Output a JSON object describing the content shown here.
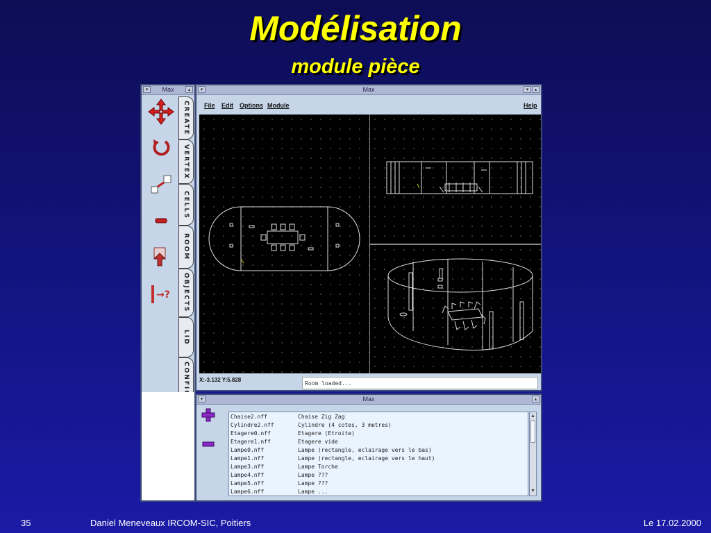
{
  "slide": {
    "title": "Modélisation",
    "subtitle": "module pièce",
    "footer_page": "35",
    "footer_author": "Daniel Meneveaux IRCOM-SIC, Poitiers",
    "footer_date": "Le 17.02.2000"
  },
  "palette": {
    "title": "Max",
    "tools": [
      "move-arrows-icon",
      "rotate-icon",
      "scale-icon",
      "minus-icon",
      "download-icon",
      "help-cursor-icon"
    ],
    "tabs": [
      "CREATE",
      "VERTEX",
      "CELLS",
      "ROOM",
      "OBJECTS",
      "LID",
      "CONFIG"
    ]
  },
  "viewer": {
    "title": "Max",
    "menu": {
      "file": "File",
      "edit": "Edit",
      "options": "Options",
      "module": "Module",
      "help": "Help"
    },
    "coords": "X:-3.132 Y:5.828",
    "status": "Room loaded..."
  },
  "files": {
    "title": "Max",
    "add_icon": "plus-icon",
    "remove_icon": "minus-icon",
    "rows": [
      {
        "file": "Chaise2.nff",
        "desc": "Chaise Zig Zag"
      },
      {
        "file": "Cylindre2.nff",
        "desc": "Cylindre (4 cotes, 3 metres)"
      },
      {
        "file": "Etagere0.nff",
        "desc": "Etagere (Etroite)"
      },
      {
        "file": "Etagere1.nff",
        "desc": "Etagere vide"
      },
      {
        "file": "Lampe0.nff",
        "desc": "Lampe (rectangle, eclairage vers le bas)"
      },
      {
        "file": "Lampe1.nff",
        "desc": "Lampe (rectangle, eclairage vers le haut)"
      },
      {
        "file": "Lampe3.nff",
        "desc": "Lampe Torche"
      },
      {
        "file": "Lampe4.nff",
        "desc": "Lampe ???"
      },
      {
        "file": "Lampe5.nff",
        "desc": "Lampe ???"
      },
      {
        "file": "Lampe6.nff",
        "desc": "Lampe ..."
      }
    ]
  }
}
